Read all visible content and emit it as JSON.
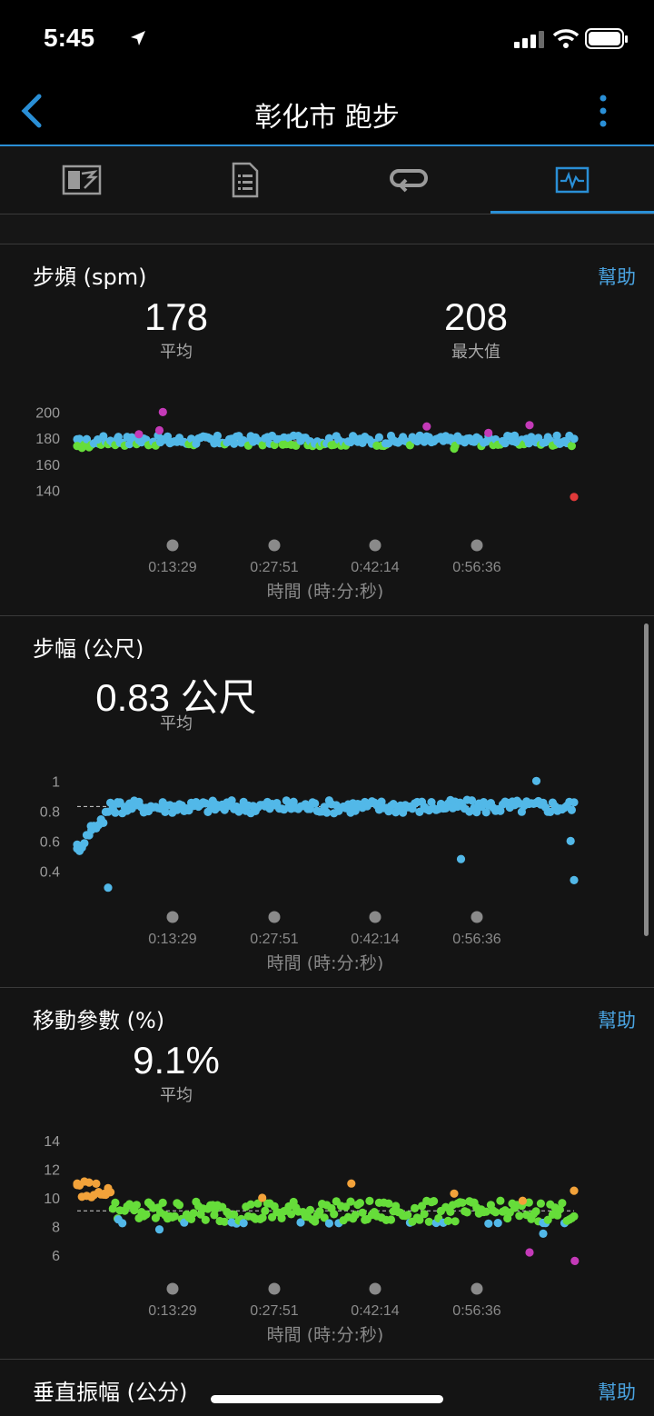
{
  "status_bar": {
    "time": "5:45"
  },
  "nav": {
    "title": "彰化市 跑步"
  },
  "tabs": [
    "overview-tab",
    "details-tab",
    "laps-tab",
    "charts-tab"
  ],
  "sections": [
    {
      "title": "步頻 (spm)",
      "help": "幫助",
      "stats": [
        {
          "value": "178",
          "label": "平均"
        },
        {
          "value": "208",
          "label": "最大值"
        }
      ]
    },
    {
      "title": "步幅 (公尺)",
      "stats": [
        {
          "value": "0.83 公尺",
          "label": "平均"
        }
      ]
    },
    {
      "title": "移動參數 (%)",
      "help": "幫助",
      "stats": [
        {
          "value": "9.1%",
          "label": "平均"
        }
      ]
    },
    {
      "title": "垂直振幅 (公分)",
      "help": "幫助"
    }
  ],
  "x_axis": {
    "ticks": [
      "0:13:29",
      "0:27:51",
      "0:42:14",
      "0:56:36"
    ],
    "label": "時間 (時:分:秒)"
  },
  "colors": {
    "accent": "#2a8fd6",
    "help": "#4aa3e0",
    "blue": "#52b8e8",
    "green": "#66dd3a",
    "purple": "#c43ab8",
    "orange": "#f2a23a",
    "red": "#e03a3a"
  },
  "chart_data": [
    {
      "type": "scatter",
      "title": "步頻 (spm)",
      "xlabel": "時間 (時:分:秒)",
      "x_ticks": [
        "0:13:29",
        "0:27:51",
        "0:42:14",
        "0:56:36"
      ],
      "y_ticks": [
        140,
        160,
        180,
        200
      ],
      "ylim": [
        130,
        210
      ],
      "average": 178,
      "max": 208,
      "approx_points": [
        {
          "x_min": 0,
          "y": 174,
          "color": "green"
        },
        {
          "x_min": 3,
          "y": 179,
          "color": "blue"
        },
        {
          "x_min": 6,
          "y": 181,
          "color": "blue"
        },
        {
          "x_min": 9,
          "y": 183,
          "color": "purple"
        },
        {
          "x_min": 12,
          "y": 186,
          "color": "purple"
        },
        {
          "x_min": 12.5,
          "y": 200,
          "color": "purple"
        },
        {
          "x_min": 20,
          "y": 176,
          "color": "blue"
        },
        {
          "x_min": 30,
          "y": 175,
          "color": "green"
        },
        {
          "x_min": 45,
          "y": 176,
          "color": "blue"
        },
        {
          "x_min": 50,
          "y": 182,
          "color": "blue"
        },
        {
          "x_min": 51,
          "y": 189,
          "color": "purple"
        },
        {
          "x_min": 55,
          "y": 172,
          "color": "green"
        },
        {
          "x_min": 60,
          "y": 184,
          "color": "purple"
        },
        {
          "x_min": 64,
          "y": 177,
          "color": "blue"
        },
        {
          "x_min": 66,
          "y": 190,
          "color": "purple"
        },
        {
          "x_min": 70,
          "y": 182,
          "color": "blue"
        },
        {
          "x_min": 72.5,
          "y": 135,
          "color": "red"
        }
      ]
    },
    {
      "type": "scatter",
      "title": "步幅 (公尺)",
      "xlabel": "時間 (時:分:秒)",
      "x_ticks": [
        "0:13:29",
        "0:27:51",
        "0:42:14",
        "0:56:36"
      ],
      "y_ticks": [
        0.4,
        0.6,
        0.8,
        1
      ],
      "ylim": [
        0.3,
        1.05
      ],
      "average": 0.83,
      "approx_points": [
        {
          "x_min": 0,
          "y": 0.55,
          "color": "blue"
        },
        {
          "x_min": 2,
          "y": 0.7,
          "color": "blue"
        },
        {
          "x_min": 4.5,
          "y": 0.29,
          "color": "blue"
        },
        {
          "x_min": 6,
          "y": 0.85,
          "color": "blue"
        },
        {
          "x_min": 20,
          "y": 0.85,
          "color": "blue"
        },
        {
          "x_min": 40,
          "y": 0.82,
          "color": "blue"
        },
        {
          "x_min": 56,
          "y": 0.48,
          "color": "blue"
        },
        {
          "x_min": 67,
          "y": 1.0,
          "color": "blue"
        },
        {
          "x_min": 72,
          "y": 0.6,
          "color": "blue"
        },
        {
          "x_min": 72.5,
          "y": 0.34,
          "color": "blue"
        }
      ]
    },
    {
      "type": "scatter",
      "title": "移動參數 (%)",
      "xlabel": "時間 (時:分:秒)",
      "x_ticks": [
        "0:13:29",
        "0:27:51",
        "0:42:14",
        "0:56:36"
      ],
      "y_ticks": [
        6,
        8,
        10,
        12,
        14
      ],
      "ylim": [
        5.5,
        14.5
      ],
      "average": 9.1,
      "approx_points": [
        {
          "x_min": 0,
          "y": 11,
          "color": "orange"
        },
        {
          "x_min": 4,
          "y": 10.3,
          "color": "orange"
        },
        {
          "x_min": 6,
          "y": 8.5,
          "color": "blue"
        },
        {
          "x_min": 12,
          "y": 7.8,
          "color": "blue"
        },
        {
          "x_min": 20,
          "y": 8.8,
          "color": "green"
        },
        {
          "x_min": 27,
          "y": 10,
          "color": "orange"
        },
        {
          "x_min": 40,
          "y": 11,
          "color": "orange"
        },
        {
          "x_min": 55,
          "y": 10.3,
          "color": "orange"
        },
        {
          "x_min": 65,
          "y": 9.8,
          "color": "orange"
        },
        {
          "x_min": 66,
          "y": 6.2,
          "color": "purple"
        },
        {
          "x_min": 68,
          "y": 7.5,
          "color": "blue"
        },
        {
          "x_min": 72.5,
          "y": 10.5,
          "color": "orange"
        },
        {
          "x_min": 72.6,
          "y": 5.6,
          "color": "purple"
        }
      ]
    }
  ]
}
